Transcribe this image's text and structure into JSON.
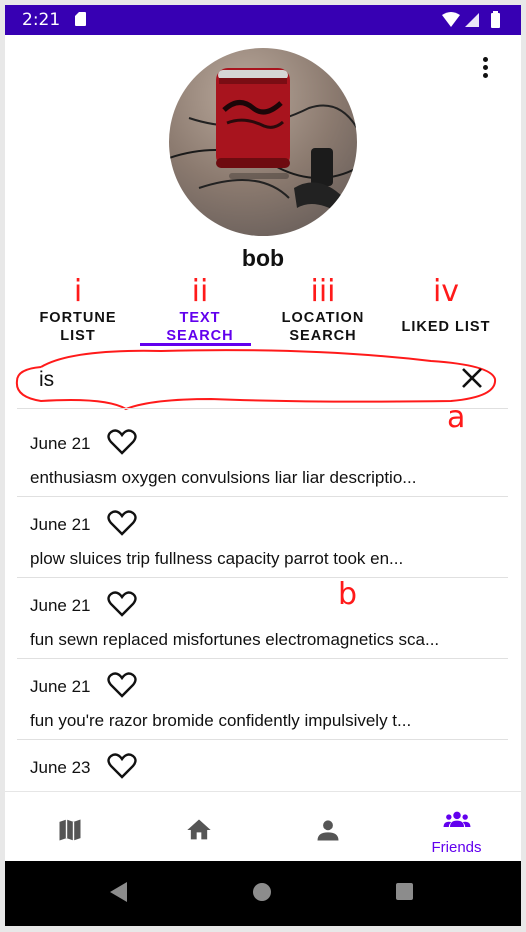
{
  "status_bar": {
    "time": "2:21"
  },
  "profile": {
    "username": "bob"
  },
  "tabs": [
    {
      "label": "FORTUNE\nLIST",
      "annotation": "i"
    },
    {
      "label": "TEXT\nSEARCH",
      "annotation": "ii"
    },
    {
      "label": "LOCATION\nSEARCH",
      "annotation": "iii"
    },
    {
      "label": "LIKED LIST",
      "annotation": "iv"
    }
  ],
  "search": {
    "value": "is",
    "annotation": "a"
  },
  "list_annotation": "b",
  "fortunes": [
    {
      "date": "June 21",
      "text": "enthusiasm oxygen convulsions liar liar descriptio..."
    },
    {
      "date": "June 21",
      "text": "plow sluices trip fullness capacity parrot took en..."
    },
    {
      "date": "June 21",
      "text": "fun sewn replaced misfortunes electromagnetics sca..."
    },
    {
      "date": "June 21",
      "text": "fun you're razor bromide confidently impulsively t..."
    },
    {
      "date": "June 23",
      "text": ""
    }
  ],
  "bottom_nav": {
    "active_label": "Friends"
  },
  "colors": {
    "primary": "#6200ee",
    "status_bar": "#3700b3",
    "annotation": "#ff1a1a"
  }
}
